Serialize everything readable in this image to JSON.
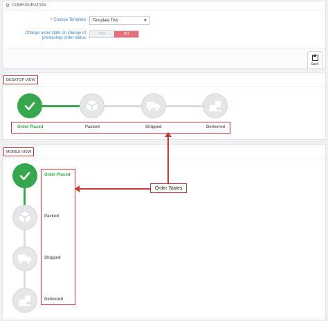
{
  "config": {
    "header": "CONFIGURATION",
    "template_label": "Choose Template",
    "template_value": "Template Two",
    "order_state_label_1": "Change order state on change of",
    "order_state_label_2": "prestashop order status",
    "yes_label": "YES",
    "no_label": "NO",
    "save_label": "Save"
  },
  "desktop": {
    "title": "DESKTOP VIEW",
    "steps": [
      "Order Placed",
      "Packed",
      "Shipped",
      "Delivered"
    ],
    "current_step": 1
  },
  "mobile": {
    "title": "MOBILE VIEW",
    "steps": [
      "Order Placed",
      "Packed",
      "Shipped",
      "Delivered"
    ]
  },
  "annotation": {
    "label": "Order States"
  },
  "colors": {
    "done": "#36a74c",
    "pending": "#e4e6e8",
    "highlight": "#c9353a"
  },
  "icons": [
    "check-icon",
    "box-icon",
    "truck-icon",
    "delivered-box-icon"
  ]
}
